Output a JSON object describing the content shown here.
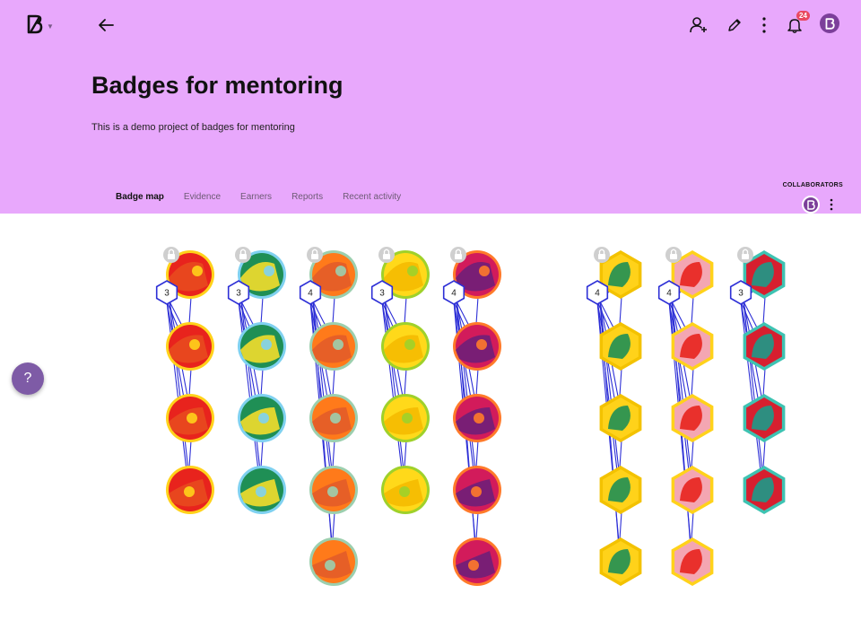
{
  "header": {
    "background_color": "#e8a8fc",
    "logo_icon": "badgr-logo-icon",
    "back_icon": "arrow-left-icon",
    "actions": [
      {
        "name": "add-person-icon"
      },
      {
        "name": "edit-pencil-icon"
      },
      {
        "name": "more-vertical-icon"
      },
      {
        "name": "bell-icon",
        "badge": "24"
      }
    ]
  },
  "project": {
    "title": "Badges for mentoring",
    "description": "This is a demo project of badges for mentoring"
  },
  "tabs": [
    {
      "label": "Badge map",
      "active": true
    },
    {
      "label": "Evidence",
      "active": false
    },
    {
      "label": "Earners",
      "active": false
    },
    {
      "label": "Reports",
      "active": false
    },
    {
      "label": "Recent activity",
      "active": false
    }
  ],
  "collaborators": {
    "label": "COLLABORATORS"
  },
  "help": {
    "label": "?"
  },
  "badge_map": {
    "columns": [
      {
        "count": "3",
        "shape": "circle",
        "palette": [
          "#e8231d",
          "#ffd21a",
          "#e84c1e"
        ],
        "badges": 4
      },
      {
        "count": "3",
        "shape": "circle",
        "palette": [
          "#1f8f55",
          "#7fd1f0",
          "#ffe22a"
        ],
        "badges": 4
      },
      {
        "count": "4",
        "shape": "circle",
        "palette": [
          "#ff7a1a",
          "#9ccfae",
          "#e25a2a"
        ],
        "badges": 5
      },
      {
        "count": "3",
        "shape": "circle",
        "palette": [
          "#ffd91a",
          "#9fd12a",
          "#f5b800"
        ],
        "badges": 4
      },
      {
        "count": "4",
        "shape": "circle",
        "palette": [
          "#d21b5b",
          "#ff7a2a",
          "#6a1f7a"
        ],
        "badges": 5
      },
      {
        "count": "4",
        "shape": "hexagon",
        "palette": [
          "#ffd21a",
          "#1f8f55",
          "#f3c200"
        ],
        "badges": 5
      },
      {
        "count": "4",
        "shape": "hexagon",
        "palette": [
          "#f4a6b2",
          "#e8231d",
          "#ffd21a"
        ],
        "badges": 5
      },
      {
        "count": "3",
        "shape": "hexagon",
        "palette": [
          "#d71f2f",
          "#1c9a8a",
          "#3ec3b2"
        ],
        "badges": 4
      }
    ],
    "link_color": "#2d2fd6",
    "lock_icon": "lock-icon"
  }
}
